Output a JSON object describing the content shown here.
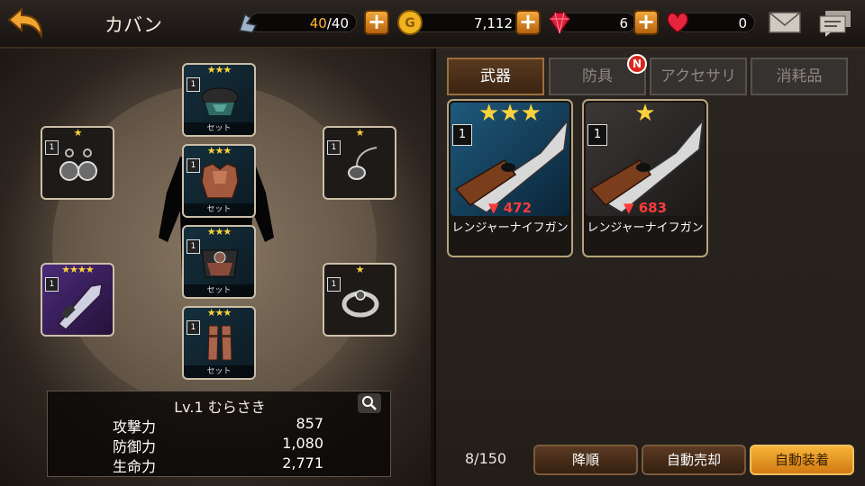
{
  "header": {
    "title": "カバン"
  },
  "resources": {
    "stamina": {
      "icon": "stamina-icon",
      "current": "40",
      "sep": "/",
      "max": "40"
    },
    "gold": {
      "icon": "gold-coin-icon",
      "value": "7,112"
    },
    "gems": {
      "icon": "ruby-gem-icon",
      "value": "6"
    },
    "hearts": {
      "icon": "heart-icon",
      "value": "0"
    }
  },
  "colors": {
    "stamina_current": "#ffb52e",
    "accent": "#f6b43a",
    "power_down": "#ff3a3a"
  },
  "equipment": [
    {
      "slot": "head",
      "stars": "★★★",
      "count": "1",
      "set": "セット"
    },
    {
      "slot": "chest",
      "stars": "★★★",
      "count": "1",
      "set": "セット"
    },
    {
      "slot": "waist",
      "stars": "★★★",
      "count": "1",
      "set": "セット"
    },
    {
      "slot": "legs",
      "stars": "★★★",
      "count": "1",
      "set": "セット"
    },
    {
      "slot": "earring",
      "stars": "★",
      "count": "1"
    },
    {
      "slot": "necklace",
      "stars": "★",
      "count": "1"
    },
    {
      "slot": "weapon",
      "stars": "★★★★",
      "count": "1"
    },
    {
      "slot": "ring",
      "stars": "★",
      "count": "1"
    }
  ],
  "character": {
    "name": "Lv.1 むらさき",
    "stats": [
      {
        "label": "攻撃力",
        "value": "857"
      },
      {
        "label": "防御力",
        "value": "1,080"
      },
      {
        "label": "生命力",
        "value": "2,771"
      }
    ]
  },
  "tabs": [
    {
      "label": "武器",
      "active": true
    },
    {
      "label": "防具",
      "badge": "N"
    },
    {
      "label": "アクセサリ"
    },
    {
      "label": "消耗品"
    }
  ],
  "items": [
    {
      "stars": "★★★",
      "count": "1",
      "power": "▼ 472",
      "name": "レンジャーナイフガン"
    },
    {
      "stars": "★",
      "count": "1",
      "power": "▼ 683",
      "name": "レンジャーナイフガン"
    }
  ],
  "inventory": {
    "capacity": "8/150"
  },
  "buttons": {
    "sort": "降順",
    "auto_sell": "自動売却",
    "auto_equip": "自動装着"
  }
}
